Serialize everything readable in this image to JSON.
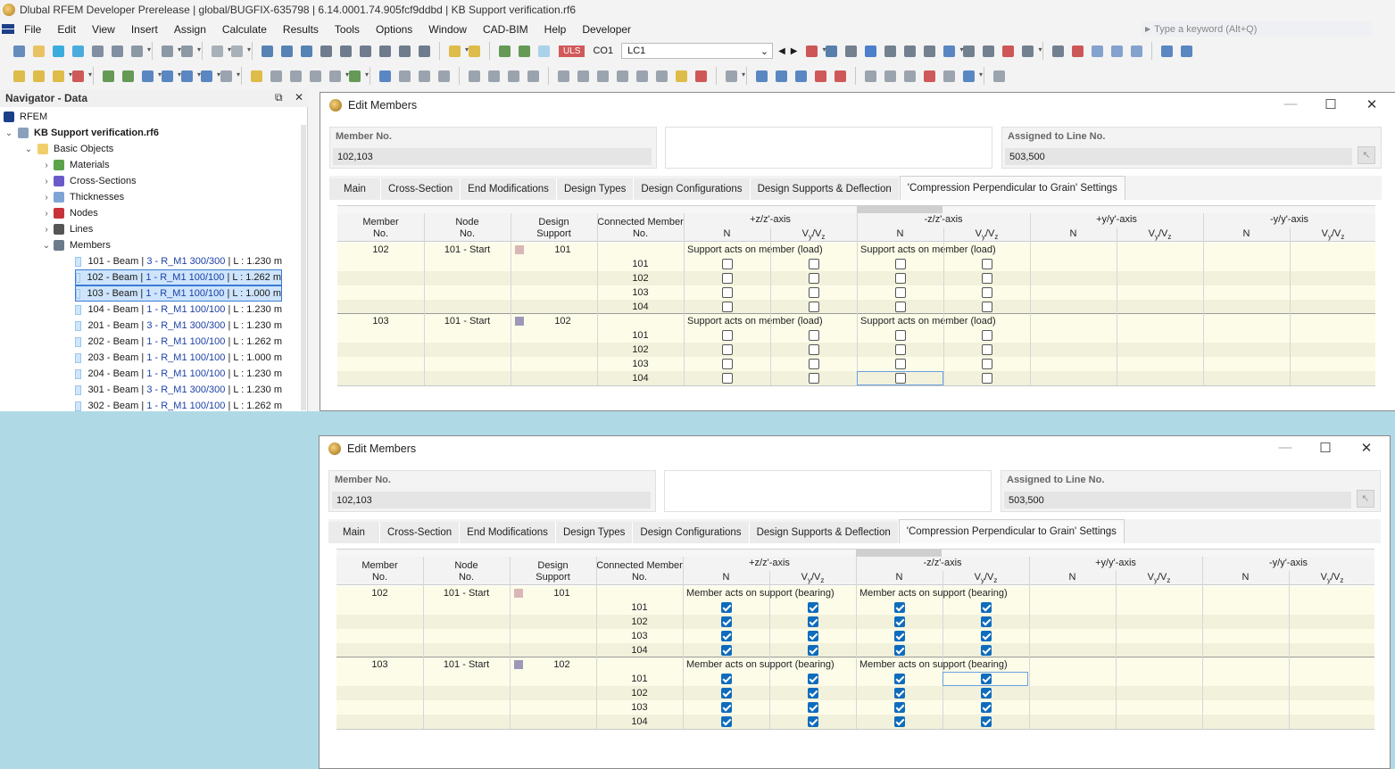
{
  "app": {
    "title": "Dlubal RFEM Developer Prerelease | global/BUGFIX-635798 | 6.14.0001.74.905fcf9ddbd | KB Support verification.rf6",
    "menu": [
      "File",
      "Edit",
      "View",
      "Insert",
      "Assign",
      "Calculate",
      "Results",
      "Tools",
      "Options",
      "Window",
      "CAD-BIM",
      "Help",
      "Developer"
    ],
    "search_placeholder": "Type a keyword (Alt+Q)"
  },
  "toolbar": {
    "uls_badge": "ULS",
    "combo": "CO1",
    "load_case": "LC1"
  },
  "navigator": {
    "title": "Navigator - Data",
    "root": "RFEM",
    "file": "KB Support verification.rf6",
    "basic_objects": "Basic Objects",
    "categories": [
      "Materials",
      "Cross-Sections",
      "Thicknesses",
      "Nodes",
      "Lines",
      "Members"
    ],
    "members": [
      {
        "id": "101",
        "type": "Beam",
        "cs_no": "3",
        "cs": "R_M1 300/300",
        "len": "1.230 m",
        "selected": false
      },
      {
        "id": "102",
        "type": "Beam",
        "cs_no": "1",
        "cs": "R_M1 100/100",
        "len": "1.262 m",
        "selected": true
      },
      {
        "id": "103",
        "type": "Beam",
        "cs_no": "1",
        "cs": "R_M1 100/100",
        "len": "1.000 m",
        "selected": true
      },
      {
        "id": "104",
        "type": "Beam",
        "cs_no": "1",
        "cs": "R_M1 100/100",
        "len": "1.230 m",
        "selected": false
      },
      {
        "id": "201",
        "type": "Beam",
        "cs_no": "3",
        "cs": "R_M1 300/300",
        "len": "1.230 m",
        "selected": false
      },
      {
        "id": "202",
        "type": "Beam",
        "cs_no": "1",
        "cs": "R_M1 100/100",
        "len": "1.262 m",
        "selected": false
      },
      {
        "id": "203",
        "type": "Beam",
        "cs_no": "1",
        "cs": "R_M1 100/100",
        "len": "1.000 m",
        "selected": false
      },
      {
        "id": "204",
        "type": "Beam",
        "cs_no": "1",
        "cs": "R_M1 100/100",
        "len": "1.230 m",
        "selected": false
      },
      {
        "id": "301",
        "type": "Beam",
        "cs_no": "3",
        "cs": "R_M1 300/300",
        "len": "1.230 m",
        "selected": false
      },
      {
        "id": "302",
        "type": "Beam",
        "cs_no": "1",
        "cs": "R_M1 100/100",
        "len": "1.262 m",
        "selected": false
      }
    ]
  },
  "dialogs": [
    {
      "title": "Edit Members",
      "member_no_label": "Member No.",
      "member_no": "102,103",
      "assigned_label": "Assigned to Line No.",
      "assigned": "503,500",
      "tabs": [
        "Main",
        "Cross-Section",
        "End Modifications",
        "Design Types",
        "Design Configurations",
        "Design Supports & Deflection",
        "'Compression Perpendicular to Grain' Settings"
      ],
      "active_tab": 6,
      "headers": {
        "member": "Member No.",
        "node": "Node No.",
        "support": "Design Support",
        "connected": "Connected Member No.",
        "pz": "+z/z'-axis",
        "mz": "-z/z'-axis",
        "py": "+y/y'-axis",
        "my": "-y/y'-axis",
        "n": "N",
        "vyvz": "Vy/Vz"
      },
      "mode_text": "Support acts on member (load)",
      "checked": false,
      "groups": [
        {
          "member": "102",
          "node": "101 - Start",
          "support": "101",
          "swatch": "#d9b7b7",
          "connected": [
            "101",
            "102",
            "103",
            "104"
          ]
        },
        {
          "member": "103",
          "node": "101 - Start",
          "support": "102",
          "swatch": "#9d98b8",
          "connected": [
            "101",
            "102",
            "103",
            "104"
          ]
        }
      ]
    },
    {
      "title": "Edit Members",
      "member_no_label": "Member No.",
      "member_no": "102,103",
      "assigned_label": "Assigned to Line No.",
      "assigned": "503,500",
      "tabs": [
        "Main",
        "Cross-Section",
        "End Modifications",
        "Design Types",
        "Design Configurations",
        "Design Supports & Deflection",
        "'Compression Perpendicular to Grain' Settings"
      ],
      "active_tab": 6,
      "headers": {
        "member": "Member No.",
        "node": "Node No.",
        "support": "Design Support",
        "connected": "Connected Member No.",
        "pz": "+z/z'-axis",
        "mz": "-z/z'-axis",
        "py": "+y/y'-axis",
        "my": "-y/y'-axis",
        "n": "N",
        "vyvz": "Vy/Vz"
      },
      "mode_text": "Member acts on support (bearing)",
      "checked": true,
      "groups": [
        {
          "member": "102",
          "node": "101 - Start",
          "support": "101",
          "swatch": "#d9b7b7",
          "connected": [
            "101",
            "102",
            "103",
            "104"
          ]
        },
        {
          "member": "103",
          "node": "101 - Start",
          "support": "102",
          "swatch": "#9d98b8",
          "connected": [
            "101",
            "102",
            "103",
            "104"
          ]
        }
      ]
    }
  ]
}
